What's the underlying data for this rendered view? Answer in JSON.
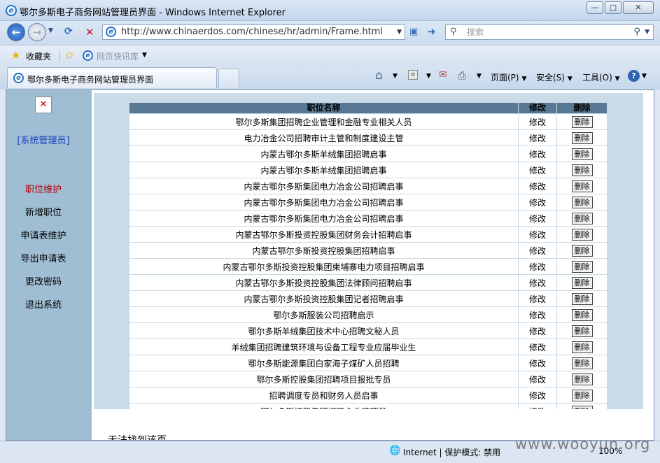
{
  "window": {
    "title": "鄂尔多斯电子商务网站管理员界面 - Windows Internet Explorer"
  },
  "address": {
    "url": "http://www.chinaerdos.com/chinese/hr/admin/Frame.html",
    "search_placeholder": "搜索"
  },
  "favorites": {
    "label": "收藏夹",
    "quick_label": "网页快讯库"
  },
  "tab": {
    "title": "鄂尔多斯电子商务网站管理员界面"
  },
  "commandbar": {
    "page": "页面(P)",
    "safety": "安全(S)",
    "tools": "工具(O)"
  },
  "sidebar": {
    "close_glyph": "✕",
    "admin_label": "[系统管理员]",
    "items": [
      "职位维护",
      "新增职位",
      "申请表维护",
      "导出申请表",
      "更改密码",
      "退出系统"
    ]
  },
  "table": {
    "headers": {
      "name": "职位名称",
      "edit": "修改",
      "delete": "删除"
    },
    "rows": [
      {
        "name": "鄂尔多斯集团招聘企业管理和金融专业相关人员",
        "edit": "修改",
        "delete": "删除"
      },
      {
        "name": "电力冶金公司招聘审计主管和制度建设主管",
        "edit": "修改",
        "delete": "删除"
      },
      {
        "name": "内蒙古鄂尔多斯羊绒集团招聘启事",
        "edit": "修改",
        "delete": "删除"
      },
      {
        "name": "内蒙古鄂尔多斯羊绒集团招聘启事",
        "edit": "修改",
        "delete": "删除"
      },
      {
        "name": "内蒙古鄂尔多斯集团电力冶金公司招聘启事",
        "edit": "修改",
        "delete": "删除"
      },
      {
        "name": "内蒙古鄂尔多斯集团电力冶金公司招聘启事",
        "edit": "修改",
        "delete": "删除"
      },
      {
        "name": "内蒙古鄂尔多斯集团电力冶金公司招聘启事",
        "edit": "修改",
        "delete": "删除"
      },
      {
        "name": "内蒙古鄂尔多斯投资控股集团财务会计招聘启事",
        "edit": "修改",
        "delete": "删除"
      },
      {
        "name": "内蒙古鄂尔多斯投资控股集团招聘启事",
        "edit": "修改",
        "delete": "删除"
      },
      {
        "name": "内蒙古鄂尔多斯投资控股集团柬埔寨电力项目招聘启事",
        "edit": "修改",
        "delete": "删除"
      },
      {
        "name": "内蒙古鄂尔多斯投资控股集团法律顾问招聘启事",
        "edit": "修改",
        "delete": "删除"
      },
      {
        "name": "内蒙古鄂尔多斯投资控股集团记者招聘启事",
        "edit": "修改",
        "delete": "删除"
      },
      {
        "name": "鄂尔多斯服装公司招聘启示",
        "edit": "修改",
        "delete": "删除"
      },
      {
        "name": "鄂尔多斯羊绒集团技术中心招聘文秘人员",
        "edit": "修改",
        "delete": "删除"
      },
      {
        "name": "羊绒集团招聘建筑环境与设备工程专业应届毕业生",
        "edit": "修改",
        "delete": "删除"
      },
      {
        "name": "鄂尔多斯能源集团白家海子煤矿人员招聘",
        "edit": "修改",
        "delete": "删除"
      },
      {
        "name": "鄂尔多斯控股集团招聘项目报批专员",
        "edit": "修改",
        "delete": "删除"
      },
      {
        "name": "招聘调度专员和财务人员启事",
        "edit": "修改",
        "delete": "删除"
      },
      {
        "name": "鄂尔多斯控股集团招聘企业管理员",
        "edit": "修改",
        "delete": "删除"
      }
    ]
  },
  "below_frame_text": "无法找到该页",
  "status": {
    "zone": "Internet | 保护模式: 禁用",
    "zoom": "100%",
    "watermark": "www.wooyun.org"
  }
}
